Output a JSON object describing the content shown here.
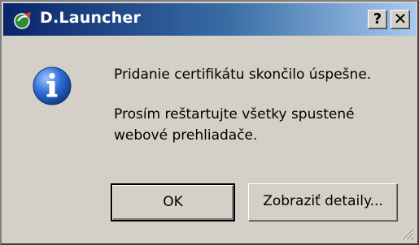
{
  "window": {
    "title": "D.Launcher",
    "help_button_label": "?",
    "close_button_label": "✕"
  },
  "message": {
    "line1": "Pridanie certifikátu skončilo úspešne.",
    "line2": "Prosím reštartujte všetky spustené",
    "line3": "webové prehliadače."
  },
  "buttons": {
    "ok_label": "OK",
    "details_label": "Zobraziť detaily..."
  },
  "icons": {
    "app": "launcher-leaf-icon",
    "message": "info-icon",
    "grip": "resize-grip-icon"
  },
  "colors": {
    "titlebar_start": "#0a246a",
    "titlebar_end": "#a6caf0",
    "dialog_face": "#d4d0c8",
    "info_icon_blue": "#1f5fbf"
  }
}
